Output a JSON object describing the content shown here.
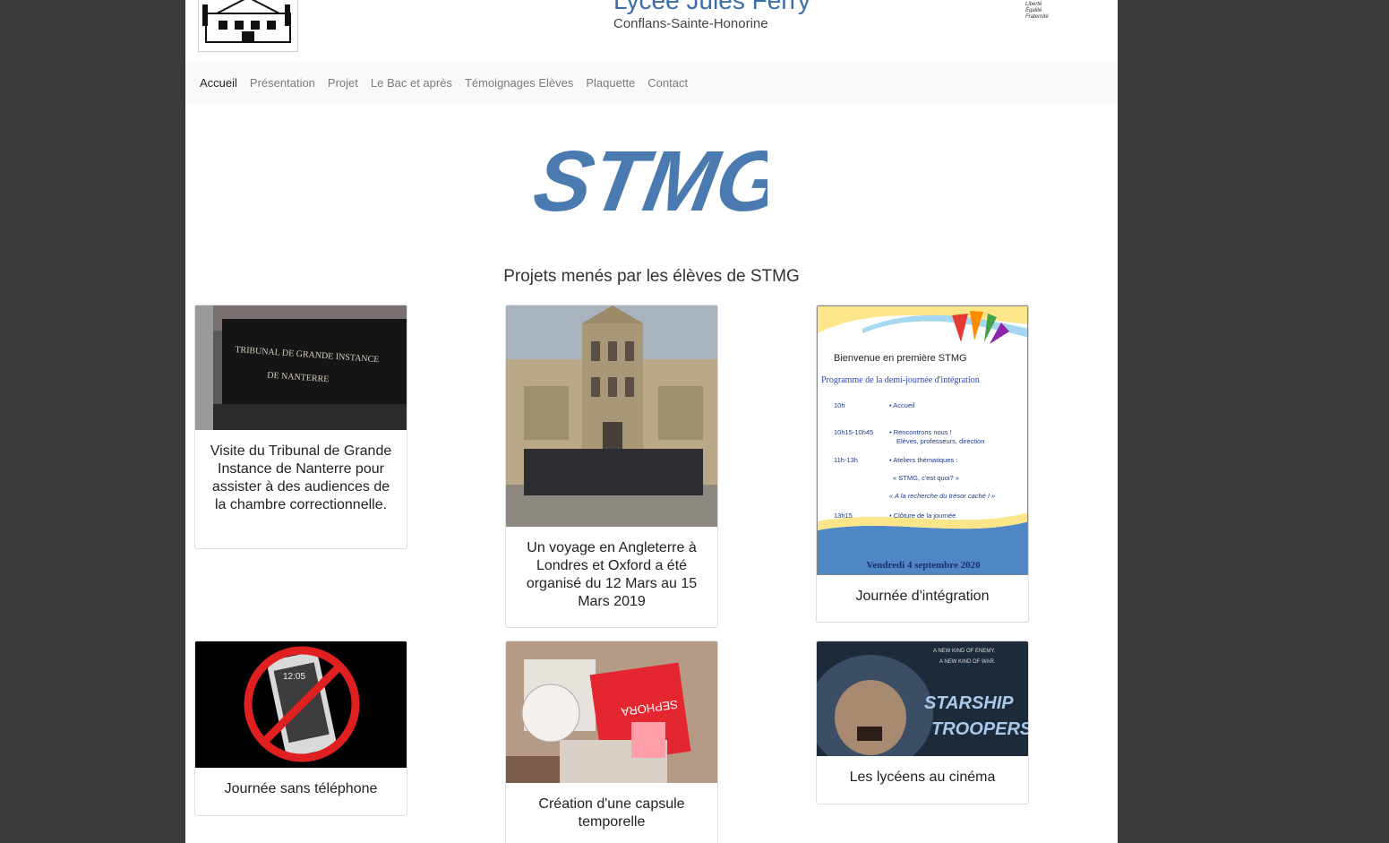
{
  "header": {
    "school_name": "Lycée Jules Ferry",
    "school_city": "Conflans-Sainte-Honorine",
    "republic_motto": [
      "Liberté",
      "Égalité",
      "Fraternité"
    ]
  },
  "nav": {
    "items": [
      "Accueil",
      "Présentation",
      "Projet",
      "Le Bac et après",
      "Témoignages Elèves",
      "Plaquette",
      "Contact"
    ],
    "active": "Accueil"
  },
  "hero": {
    "title": "STMG",
    "color": "#4a7ab0"
  },
  "section": {
    "title": "Projets menés par les élèves de STMG"
  },
  "cards": [
    {
      "caption": "Visite du Tribunal de Grande Instance de Nanterre pour assister à des audiences de la chambre correctionnelle.",
      "image_text": [
        "TRIBUNAL DE GRANDE INSTANCE",
        "DE NANTERRE"
      ]
    },
    {
      "caption": "Un voyage en Angleterre à Londres et Oxford a été organisé du 12 Mars au 15 Mars 2019"
    },
    {
      "caption": "Journée d'intégration",
      "poster": {
        "welcome": "Bienvenue en première STMG",
        "programme": "Programme de la demi-journée d'intégration",
        "rows": [
          {
            "time": "10h",
            "text": "• Accueil"
          },
          {
            "time": "10h15-10h45",
            "text": "• Rencontrons nous !"
          },
          {
            "time": "",
            "text": "Elèves, professeurs, direction"
          },
          {
            "time": "11h-13h",
            "text": "• Ateliers thématiques :"
          },
          {
            "time": "",
            "text": "« STMG, c'est quoi? »"
          },
          {
            "time": "",
            "text": "« A la recherche du trésor caché ! »"
          },
          {
            "time": "13h15",
            "text": "• Clôture de la journée"
          }
        ],
        "date": "Vendredi 4 septembre 2020"
      }
    },
    {
      "caption": "Journée sans téléphone",
      "image_text": "12:05"
    },
    {
      "caption": "Création d'une capsule temporelle",
      "image_text": "SEPHORA"
    },
    {
      "caption": "Les lycéens au cinéma",
      "image_text": [
        "A NEW KIND OF ENEMY.",
        "A NEW KIND OF WAR.",
        "STARSHIP",
        "TROOPERS"
      ]
    }
  ]
}
